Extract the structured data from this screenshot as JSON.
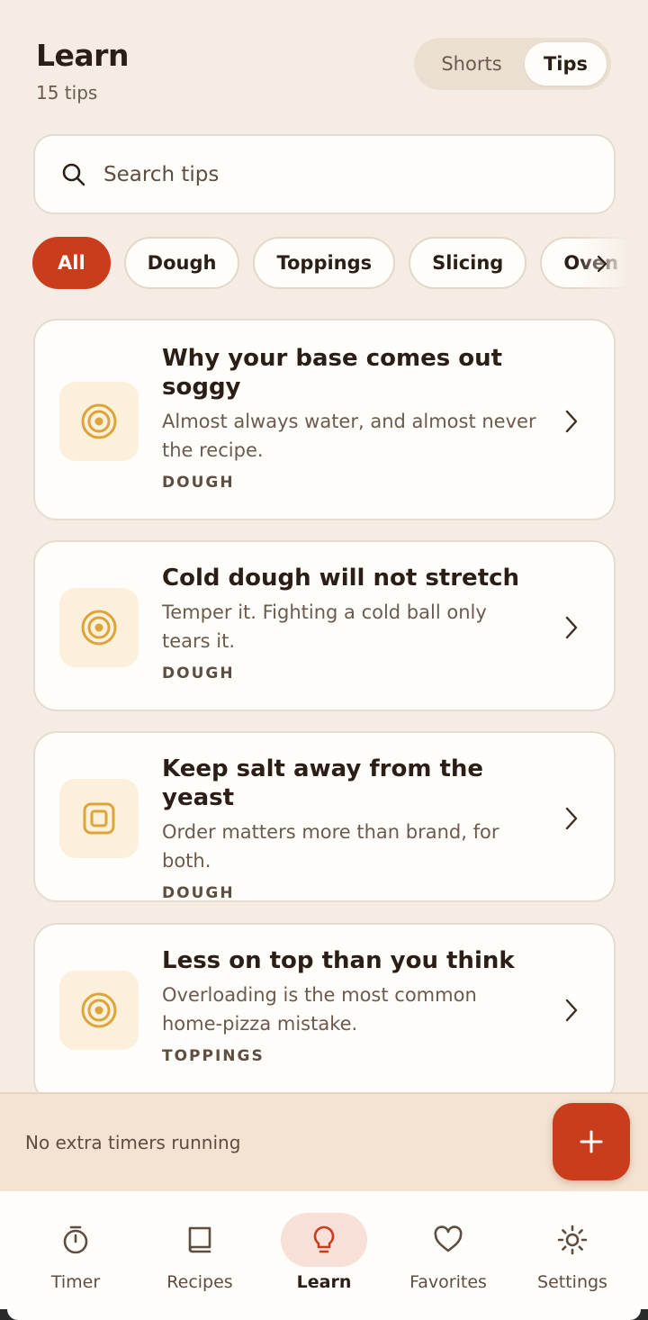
{
  "header": {
    "title": "Learn",
    "subtitle": "15 tips"
  },
  "segmented": {
    "options": [
      "Shorts",
      "Tips"
    ],
    "selected": "Tips"
  },
  "search": {
    "placeholder": "Search tips",
    "value": ""
  },
  "chips": [
    {
      "label": "All",
      "active": true
    },
    {
      "label": "Dough",
      "active": false
    },
    {
      "label": "Toppings",
      "active": false
    },
    {
      "label": "Slicing",
      "active": false
    },
    {
      "label": "Oven",
      "active": false
    }
  ],
  "tips": [
    {
      "title": "Why your base comes out soggy",
      "description": "Almost always water, and almost never the recipe.",
      "category": "DOUGH",
      "icon": "concentric-circle-icon"
    },
    {
      "title": "Cold dough will not stretch",
      "description": "Temper it. Fighting a cold ball only tears it.",
      "category": "DOUGH",
      "icon": "concentric-circle-icon"
    },
    {
      "title": "Keep salt away from the yeast",
      "description": "Order matters more than brand, for both.",
      "category": "DOUGH",
      "icon": "square-target-icon"
    },
    {
      "title": "Less on top than you think",
      "description": "Overloading is the most common home-pizza mistake.",
      "category": "TOPPINGS",
      "icon": "concentric-circle-icon"
    }
  ],
  "timer_bar": {
    "text": "No extra timers running"
  },
  "nav": [
    {
      "label": "Timer",
      "icon": "stopwatch-icon",
      "active": false
    },
    {
      "label": "Recipes",
      "icon": "book-icon",
      "active": false
    },
    {
      "label": "Learn",
      "icon": "lightbulb-icon",
      "active": true
    },
    {
      "label": "Favorites",
      "icon": "heart-icon",
      "active": false
    },
    {
      "label": "Settings",
      "icon": "gear-icon",
      "active": false
    }
  ],
  "colors": {
    "accent": "#c93d1c",
    "background": "#f5ede4",
    "card": "#fffdf9",
    "icon_gold": "#dba53a"
  }
}
